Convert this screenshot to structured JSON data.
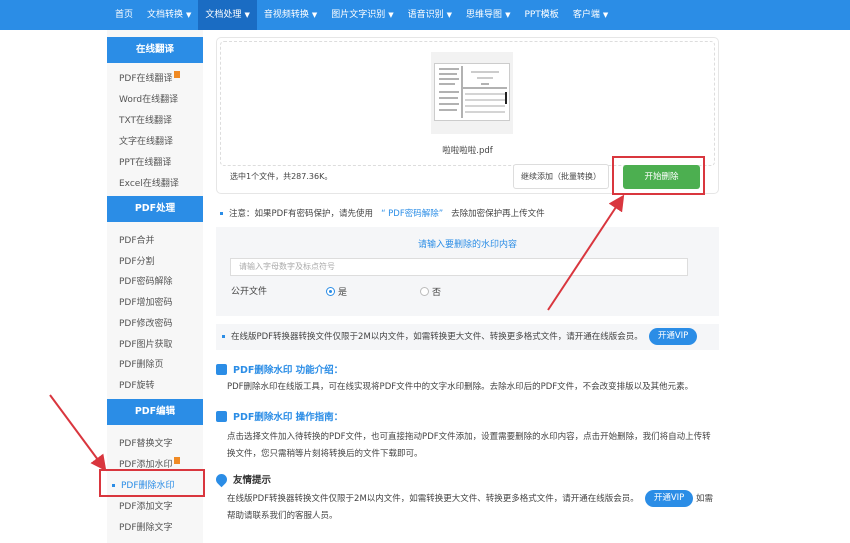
{
  "nav": {
    "items": [
      "首页",
      "文档转换",
      "文档处理",
      "音视频转换",
      "图片文字识别",
      "语音识别",
      "思维导图",
      "PPT模板",
      "客户端"
    ],
    "carets": [
      false,
      true,
      true,
      true,
      true,
      true,
      true,
      false,
      true
    ],
    "active": 2
  },
  "sidebar": {
    "groups": [
      {
        "title": "在线翻译",
        "items": [
          "PDF在线翻译",
          "Word在线翻译",
          "TXT在线翻译",
          "文字在线翻译",
          "PPT在线翻译",
          "Excel在线翻译"
        ]
      },
      {
        "title": "PDF处理",
        "items": [
          "PDF合并",
          "PDF分割",
          "PDF密码解除",
          "PDF增加密码",
          "PDF修改密码",
          "PDF图片获取",
          "PDF删除页",
          "PDF旋转"
        ]
      },
      {
        "title": "PDF编辑",
        "items": [
          "PDF替换文字",
          "PDF添加水印",
          "PDF删除水印",
          "PDF添加文字",
          "PDF删除文字"
        ]
      }
    ],
    "active": "PDF删除水印"
  },
  "upload": {
    "filename": "啦啦啦啦.pdf",
    "selected": "选中1个文件，共287.36K。",
    "add_label": "继续添加（批量转换）",
    "start_label": "开始删除"
  },
  "note": {
    "prefix": "注意：如果PDF有密码保护，请先使用",
    "link": "“ PDF密码解除”",
    "suffix": "去除加密保护再上传文件"
  },
  "watermark": {
    "title": "请输入要删除的水印内容",
    "placeholder": "请输入字母数字及标点符号",
    "public_label": "公开文件",
    "yes": "是",
    "no": "否",
    "selected": "是"
  },
  "vipbar": {
    "text": "在线版PDF转换器转换文件仅限于2M以内文件，如需转换更大文件、转换更多格式文件，请开通在线版会员。",
    "button": "开通VIP"
  },
  "intro": {
    "title": "PDF删除水印 功能介绍：",
    "text": "PDF删除水印在线版工具，可在线实现将PDF文件中的文字水印删除。去除水印后的PDF文件，不会改变排版以及其他元素。"
  },
  "guide": {
    "title": "PDF删除水印 操作指南：",
    "text": "点击选择文件加入待转换的PDF文件，也可直接拖动PDF文件添加，设置需要删除的水印内容，点击开始删除，我们将自动上传转换文件，您只需稍等片刻将转换后的文件下载即可。"
  },
  "tips": {
    "title": "友情提示",
    "text": "在线版PDF转换器转换文件仅限于2M以内文件，如需转换更大文件、转换更多格式文件，请开通在线版会员。",
    "button": "开通VIP",
    "suffix": "如需帮助请联系我们的客服人员。"
  },
  "colors": {
    "brand": "#2b8de6",
    "nav_active": "#1a6cc3",
    "start": "#4caf50",
    "annotation": "#d9363e"
  }
}
